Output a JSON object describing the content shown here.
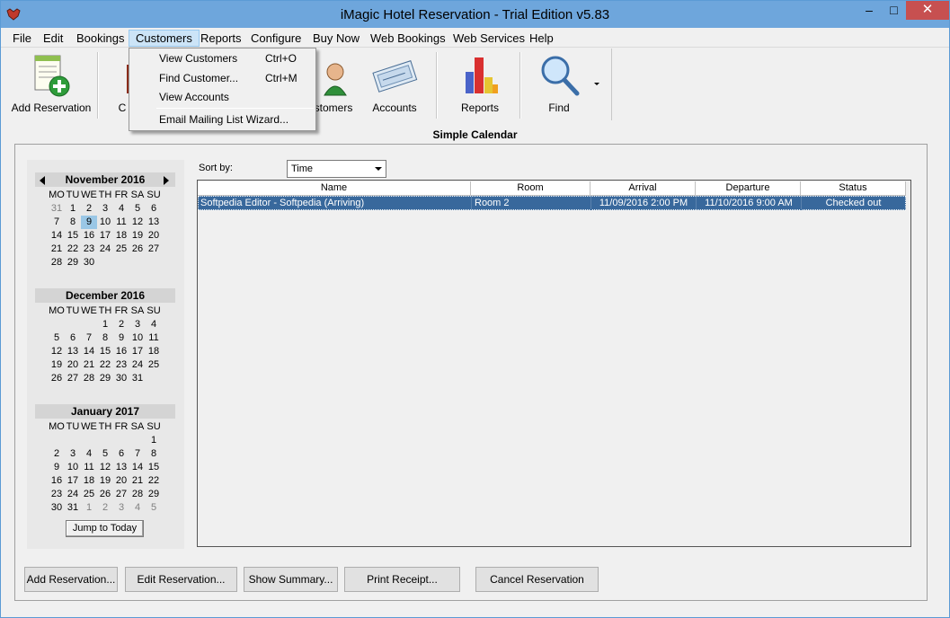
{
  "window": {
    "title": "iMagic Hotel Reservation - Trial Edition v5.83",
    "minimize": "–",
    "maximize": "□",
    "close": "✕"
  },
  "menu": [
    "File",
    "Edit",
    "Bookings",
    "Customers",
    "Reports",
    "Configure",
    "Buy Now",
    "Web Bookings",
    "Web Services",
    "Help"
  ],
  "customers_menu": {
    "items": [
      {
        "label": "View Customers",
        "shortcut": "Ctrl+O"
      },
      {
        "label": "Find Customer...",
        "shortcut": "Ctrl+M"
      },
      {
        "label": "View Accounts",
        "shortcut": ""
      },
      {
        "label": "Email Mailing List Wizard...",
        "shortcut": ""
      }
    ]
  },
  "toolbar": {
    "add_reservation": "Add Reservation",
    "calendar_partial": "C",
    "customers_partial": "stomers",
    "accounts": "Accounts",
    "reports": "Reports",
    "find": "Find",
    "icons": [
      "add-reservation-icon",
      "calendar-icon",
      "customers-icon",
      "accounts-icon",
      "reports-icon",
      "find-icon"
    ]
  },
  "main": {
    "title": "Simple Calendar",
    "sort_label": "Sort by:",
    "sort_value": "Time"
  },
  "calendar": {
    "dow": [
      "MO",
      "TU",
      "WE",
      "TH",
      "FR",
      "SA",
      "SU"
    ],
    "jump_label": "Jump to Today",
    "months": [
      {
        "name": "November 2016",
        "weeks": [
          [
            "31",
            "1",
            "2",
            "3",
            "4",
            "5",
            "6"
          ],
          [
            "7",
            "8",
            "9",
            "10",
            "11",
            "12",
            "13"
          ],
          [
            "14",
            "15",
            "16",
            "17",
            "18",
            "19",
            "20"
          ],
          [
            "21",
            "22",
            "23",
            "24",
            "25",
            "26",
            "27"
          ],
          [
            "28",
            "29",
            "30",
            "",
            "",
            "",
            ""
          ]
        ],
        "selected": "9"
      },
      {
        "name": "December 2016",
        "weeks": [
          [
            "",
            "",
            "",
            "1",
            "2",
            "3",
            "4"
          ],
          [
            "5",
            "6",
            "7",
            "8",
            "9",
            "10",
            "11"
          ],
          [
            "12",
            "13",
            "14",
            "15",
            "16",
            "17",
            "18"
          ],
          [
            "19",
            "20",
            "21",
            "22",
            "23",
            "24",
            "25"
          ],
          [
            "26",
            "27",
            "28",
            "29",
            "30",
            "31",
            ""
          ]
        ]
      },
      {
        "name": "January 2017",
        "weeks": [
          [
            "",
            "",
            "",
            "",
            "",
            "",
            "1"
          ],
          [
            "2",
            "3",
            "4",
            "5",
            "6",
            "7",
            "8"
          ],
          [
            "9",
            "10",
            "11",
            "12",
            "13",
            "14",
            "15"
          ],
          [
            "16",
            "17",
            "18",
            "19",
            "20",
            "21",
            "22"
          ],
          [
            "23",
            "24",
            "25",
            "26",
            "27",
            "28",
            "29"
          ],
          [
            "30",
            "31",
            "1",
            "2",
            "3",
            "4",
            "5"
          ]
        ]
      }
    ]
  },
  "table": {
    "columns": [
      "Name",
      "Room",
      "Arrival",
      "Departure",
      "Status"
    ],
    "rows": [
      [
        "Softpedia Editor - Softpedia (Arriving)",
        "Room 2",
        "11/09/2016 2:00 PM",
        "11/10/2016 9:00 AM",
        "Checked out"
      ]
    ]
  },
  "buttons": [
    "Add Reservation...",
    "Edit Reservation...",
    "Show Summary...",
    "Print Receipt...",
    "Cancel Reservation"
  ]
}
